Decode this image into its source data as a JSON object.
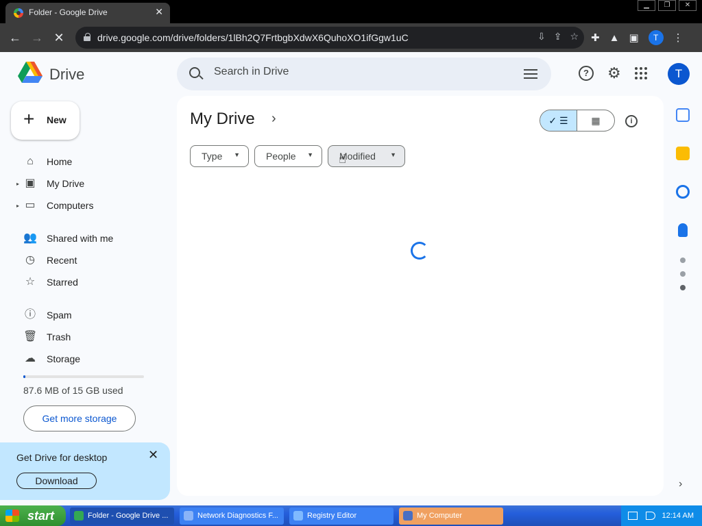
{
  "browser": {
    "tab_title": "Folder - Google Drive",
    "tab_close": "✕",
    "window_buttons": [
      "▁",
      "❐",
      "✕"
    ],
    "url": "drive.google.com/drive/folders/1lBh2Q7FrtbgbXdwX6QuhoXO1ifGgw1uC",
    "profile_initial": "T"
  },
  "drive": {
    "logo_text": "Drive",
    "search_placeholder": "Search in Drive",
    "avatar_initial": "T",
    "new_button": "New",
    "nav": [
      {
        "label": "Home",
        "icon": "home-icon"
      },
      {
        "label": "My Drive",
        "icon": "my-drive-icon"
      },
      {
        "label": "Computers",
        "icon": "computer-icon"
      },
      {
        "label": "Shared with me",
        "icon": "people-icon"
      },
      {
        "label": "Recent",
        "icon": "clock-icon"
      },
      {
        "label": "Starred",
        "icon": "star-icon"
      },
      {
        "label": "Spam",
        "icon": "spam-icon"
      },
      {
        "label": "Trash",
        "icon": "trash-icon"
      },
      {
        "label": "Storage",
        "icon": "cloud-icon"
      }
    ],
    "storage": {
      "text": "87.6 MB of 15 GB used",
      "used_fraction": 0.006
    },
    "get_storage_button": "Get more storage",
    "promo": {
      "title": "Get Drive for desktop",
      "button": "Download"
    },
    "breadcrumb": "My Drive",
    "filters": [
      "Type",
      "People",
      "Modified"
    ]
  },
  "taskbar": {
    "start": "start",
    "items": [
      {
        "label": "Folder - Google Drive ...",
        "state": "active"
      },
      {
        "label": "Network Diagnostics F...",
        "state": "normal"
      },
      {
        "label": "Registry Editor",
        "state": "normal"
      },
      {
        "label": "My Computer",
        "state": "highlight"
      }
    ],
    "clock": "12:14 AM"
  },
  "colors": {
    "accent": "#0b57d0",
    "page_bg": "#f8fafd",
    "selected_toggle": "#c2e7ff"
  }
}
